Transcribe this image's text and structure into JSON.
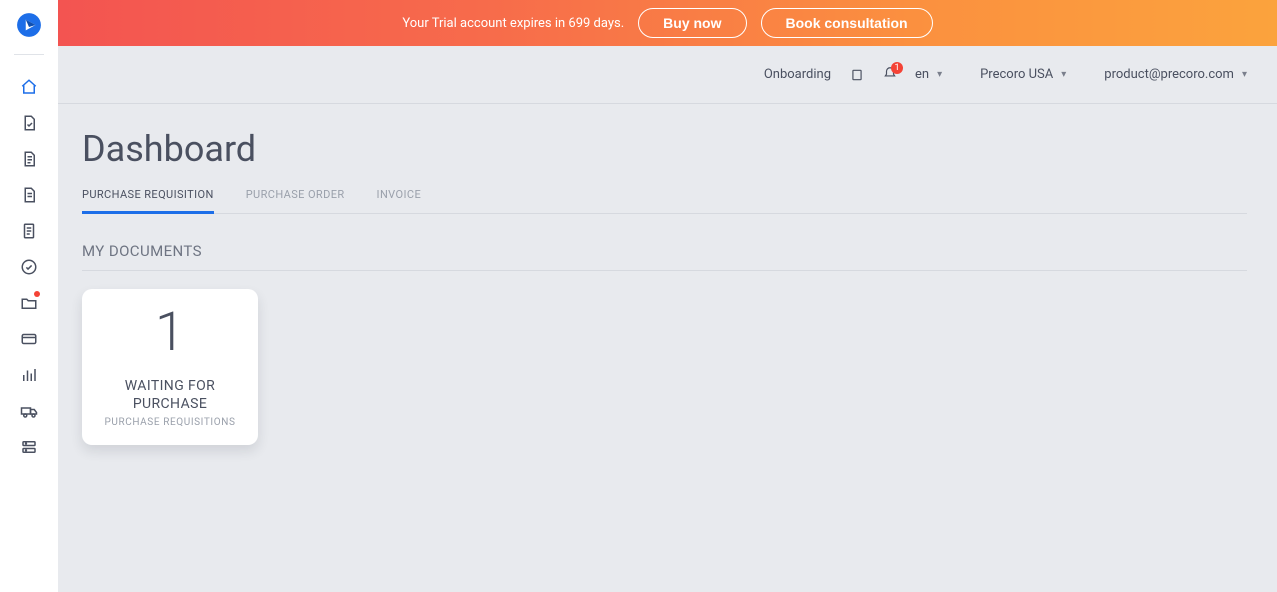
{
  "banner": {
    "message": "Your Trial account expires in 699 days.",
    "buy_label": "Buy now",
    "book_label": "Book consultation"
  },
  "header": {
    "onboarding_label": "Onboarding",
    "notifications_count": "1",
    "language": "en",
    "company": "Precoro USA",
    "user_email": "product@precoro.com"
  },
  "page": {
    "title": "Dashboard",
    "section_title": "MY DOCUMENTS"
  },
  "tabs": [
    {
      "label": "PURCHASE REQUISITION",
      "active": true
    },
    {
      "label": "PURCHASE ORDER",
      "active": false
    },
    {
      "label": "INVOICE",
      "active": false
    }
  ],
  "cards": [
    {
      "count": "1",
      "status_line1": "WAITING FOR",
      "status_line2": "PURCHASE",
      "subtitle": "PURCHASE REQUISITIONS"
    }
  ],
  "sidebar": {
    "items": [
      "dashboard",
      "purchase-requisition",
      "purchase-order",
      "invoice",
      "receipt",
      "approvals",
      "products",
      "payments",
      "reports",
      "suppliers",
      "settings"
    ]
  },
  "colors": {
    "accent": "#1d6ee8",
    "icon": "#4a5060",
    "danger": "#f44336"
  }
}
